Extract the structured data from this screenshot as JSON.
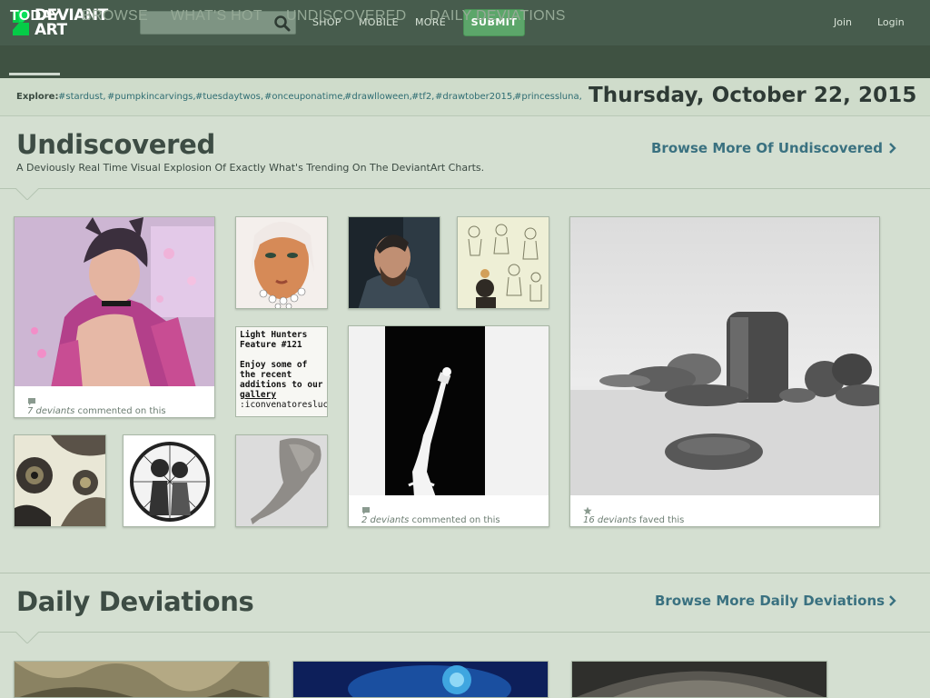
{
  "brand": {
    "line1": "DEVIANT",
    "line2": "ART"
  },
  "search": {
    "placeholder": ""
  },
  "topnav": {
    "shop": "SHOP",
    "mobile": "MOBILE",
    "more": "MORE",
    "submit": "SUBMIT",
    "join": "Join",
    "login": "Login"
  },
  "tabs": [
    "TODAY",
    "BROWSE",
    "WHAT'S HOT",
    "UNDISCOVERED",
    "DAILY DEVIATIONS"
  ],
  "explore": {
    "label": "Explore:",
    "tags": [
      "#stardust,",
      "#pumpkincarvings,",
      "#tuesdaytwos,",
      "#onceuponatime,",
      "#drawlloween,",
      "#tf2,",
      "#drawtober2015,",
      "#princessluna,"
    ]
  },
  "date": "Thursday, October 22, 2015",
  "undiscovered": {
    "title": "Undiscovered",
    "subtitle": "A Deviously Real Time Visual Explosion Of Exactly What's Trending On The DeviantArt Charts.",
    "browse_more": "Browse More Of Undiscovered"
  },
  "cards": {
    "catboy": {
      "count": "7 deviants",
      "action": "commented on this"
    },
    "torch": {
      "count": "2 deviants",
      "action": "commented on this"
    },
    "rocks": {
      "count": "16 deviants",
      "action": "faved this"
    }
  },
  "text_card": {
    "title": "Light Hunters Feature #121",
    "body": "Enjoy some of the recent additions to our",
    "link": "gallery",
    "user": ":iconvenatoreslucis:"
  },
  "daily": {
    "title": "Daily Deviations",
    "browse_more": "Browse More Daily Deviations"
  },
  "colors": {
    "header": "#475c4d",
    "tabbar": "#3f5242",
    "submit": "#5ca66a",
    "link": "#3a7180",
    "page": "#d4dfd1"
  },
  "icons": [
    "search-icon",
    "chevron-right-icon",
    "comment-icon",
    "star-icon"
  ]
}
